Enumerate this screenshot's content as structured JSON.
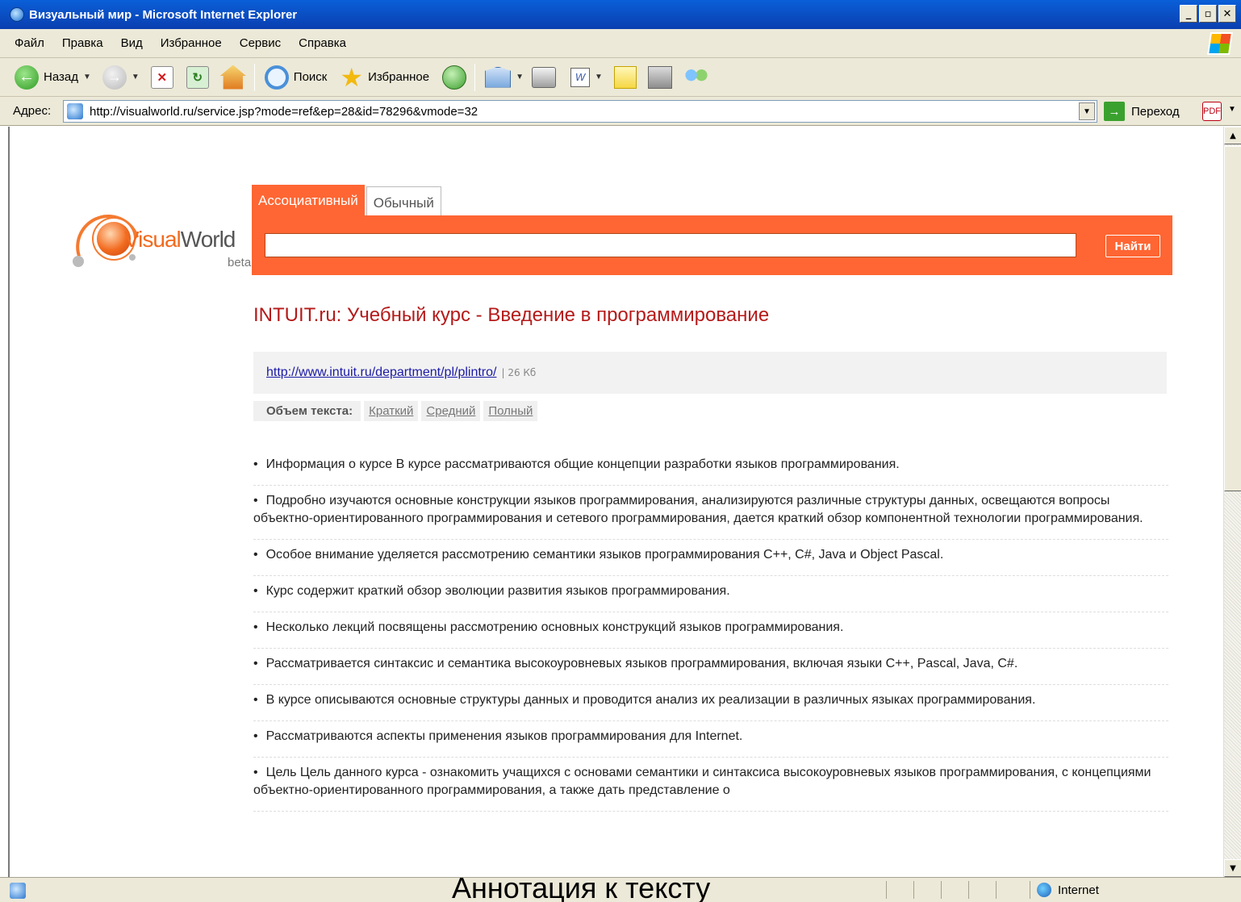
{
  "window": {
    "title": "Визуальный мир - Microsoft Internet Explorer"
  },
  "menu": [
    "Файл",
    "Правка",
    "Вид",
    "Избранное",
    "Сервис",
    "Справка"
  ],
  "toolbar": {
    "back_label": "Назад",
    "search_label": "Поиск",
    "favorites_label": "Избранное"
  },
  "address": {
    "label": "Адрес:",
    "url": "http://visualworld.ru/service.jsp?mode=ref&ep=28&id=78296&vmode=32",
    "go_label": "Переход"
  },
  "site": {
    "logo_text_1": "Visual",
    "logo_text_2": "World",
    "beta": "beta",
    "tabs": [
      "Ассоциативный",
      "Обычный"
    ],
    "search_button": "Найти"
  },
  "doc": {
    "title": "INTUIT.ru: Учебный курс - Введение в программирование",
    "url": "http://www.intuit.ru/department/pl/plintro/",
    "size": "| 26 Кб",
    "volume_label": "Объем текста:",
    "volume_options": [
      "Краткий",
      "Средний",
      "Полный"
    ],
    "abstract": [
      "Информация о курсе В курсе рассматриваются общие концепции разработки языков программирования.",
      "Подробно изучаются основные конструкции языков программирования, анализируются различные структуры данных, освещаются вопросы объектно-ориентированного программирования и сетевого программирования, дается краткий обзор компонентной технологии программирования.",
      "Особое внимание уделяется рассмотрению семантики языков программирования C++, C#, Java и Object Pascal.",
      "Курс содержит краткий обзор эволюции развития языков программирования.",
      "Несколько лекций посвящены рассмотрению основных конструкций языков программирования.",
      "Рассматривается синтаксис и семантика высокоуровневых языков программирования, включая языки C++, Pascal, Java, C#.",
      "В курсе описываются основные структуры данных и проводится анализ их реализации в различных языках программирования.",
      "Рассматриваются аспекты применения языков программирования для Internet.",
      "Цель Цель данного курса - ознакомить учащихся с основами семантики и синтаксиса высокоуровневых языков программирования, с концепциями объектно-ориентированного программирования, а также дать представление о"
    ]
  },
  "status": {
    "caption": "Аннотация к тексту",
    "zone": "Internet"
  }
}
